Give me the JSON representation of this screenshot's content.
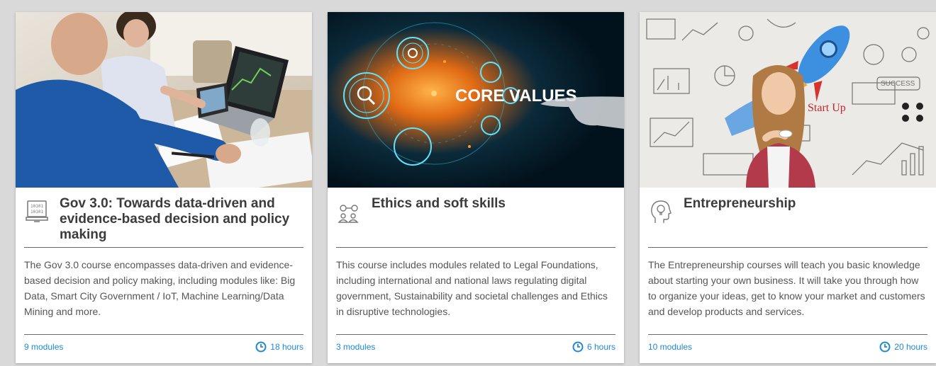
{
  "cards": [
    {
      "title": "Gov 3.0: Towards data-driven and evidence-based decision and policy making",
      "icon": "binary-monitor-icon",
      "image": "meeting-laptop-charts-image",
      "description": "The Gov 3.0 course encompasses data-driven and evidence-based decision and policy making, including modules like: Big Data, Smart City Government / IoT, Machine Learning/Data Mining and more.",
      "modules": "9 modules",
      "hours": "18 hours"
    },
    {
      "title": "Ethics and soft skills",
      "icon": "people-network-icon",
      "image": "core-values-digital-image",
      "image_text": "CORE VALUES",
      "description": "This course includes modules related to Legal Foundations, including international and national laws regulating digital government, Sustainability and societal challenges and Ethics in disruptive technologies.",
      "modules": "3 modules",
      "hours": "6 hours"
    },
    {
      "title": "Entrepreneurship",
      "icon": "head-lightbulb-icon",
      "image": "startup-rocket-woman-image",
      "image_text_1": "Start Up",
      "image_text_2": "SUCCESS",
      "description": "The Entrepreneurship courses will teach you basic knowledge about starting your own business. It will take you through how to organize your ideas, get to know your market and customers and develop products and services.",
      "modules": "10 modules",
      "hours": "20 hours"
    }
  ],
  "colors": {
    "accent": "#1e88d6",
    "title": "#3b3b3b",
    "text": "#555555",
    "background": "#d9d9d9"
  }
}
